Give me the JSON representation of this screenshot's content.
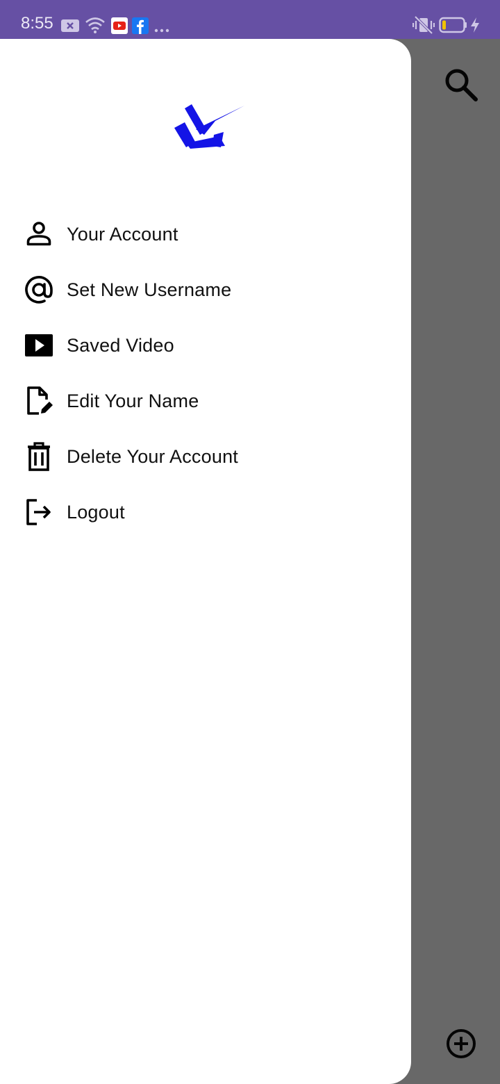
{
  "status_bar": {
    "time": "8:55",
    "left_icons": [
      "close-notification-icon",
      "wifi-icon",
      "youtube-icon",
      "facebook-icon",
      "more-dots-icon"
    ],
    "right_icons": [
      "vibrate-off-icon",
      "battery-low-icon",
      "charging-bolt-icon"
    ]
  },
  "colors": {
    "status_bar": "#6650a4",
    "scrim": "#686868",
    "drawer": "#ffffff",
    "logo": "#1414e6",
    "text": "#111111",
    "battery_fill": "#f2c200"
  },
  "drawer": {
    "logo": "app-logo",
    "menu": [
      {
        "label": "Your Account",
        "icon": "person-icon"
      },
      {
        "label": "Set New Username",
        "icon": "at-sign-icon"
      },
      {
        "label": "Saved Video",
        "icon": "play-video-icon"
      },
      {
        "label": "Edit Your Name",
        "icon": "edit-file-icon"
      },
      {
        "label": "Delete Your Account",
        "icon": "trash-icon"
      },
      {
        "label": "Logout",
        "icon": "logout-icon"
      }
    ]
  },
  "background_screen": {
    "top_right": "search-icon",
    "bottom_right": "add-circle-icon"
  }
}
